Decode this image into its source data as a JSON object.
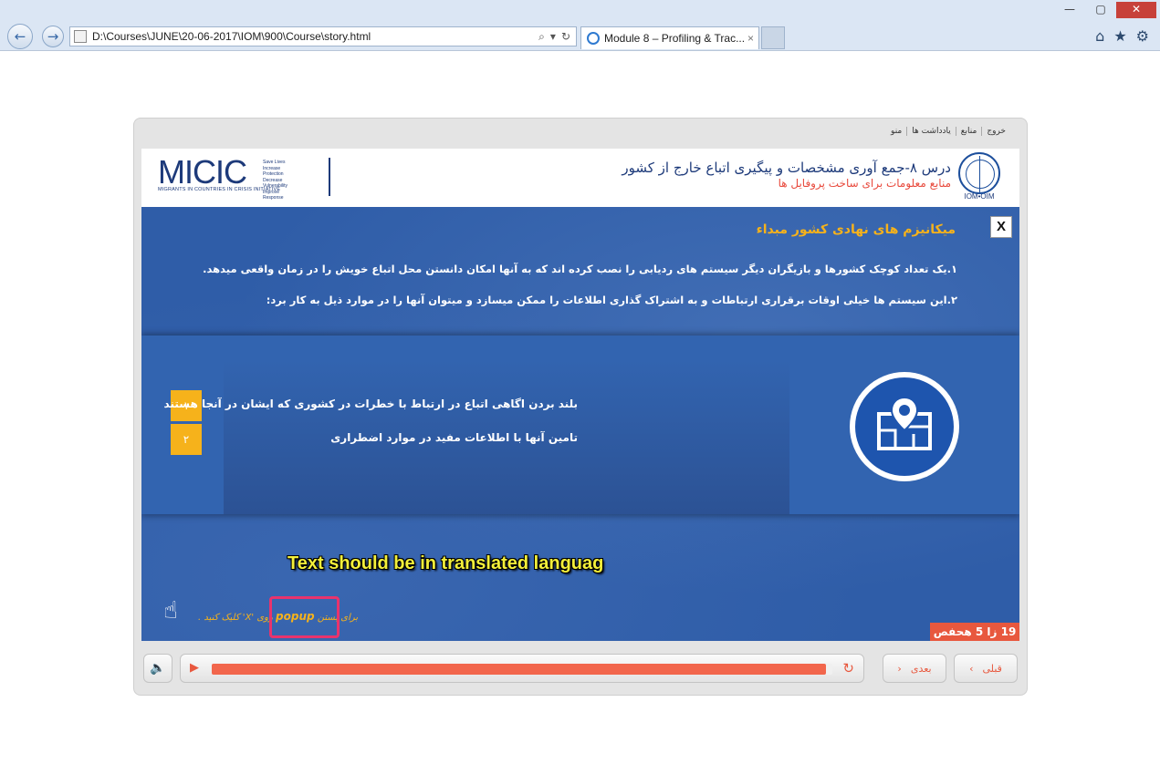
{
  "browser": {
    "address_url": "D:\\Courses\\JUNE\\20-06-2017\\IOM\\900\\Course\\story.html",
    "tab_title": "Module 8 – Profiling & Trac...",
    "tab_close": "×",
    "back_glyph": "←",
    "forward_glyph": "→",
    "search_glyph": "⌕",
    "dropdown_glyph": "▾",
    "refresh_glyph": "↻",
    "home_glyph": "⌂",
    "fav_glyph": "★",
    "settings_glyph": "⚙",
    "minimize_glyph": "—",
    "maximize_glyph": "▢",
    "close_glyph": "✕"
  },
  "topnav": {
    "menu": "منو",
    "notes": "یادداشت ها",
    "resources": "منابع",
    "exit": "خروج"
  },
  "header": {
    "micic_logo": "MICIC",
    "micic_tagline": [
      "Save Lives",
      "Increase Protection",
      "Decrease Vulnerability",
      "Improve Response"
    ],
    "micic_subtitle": "MIGRANTS IN COUNTRIES IN CRISIS INITIATIVE",
    "title": "درس ۸-جمع آوری مشخصات و پیگیری اتباع خارج از کشور",
    "subtitle": "منابع معلومات برای ساخت پروفایل ها",
    "iom_label": "IOM•OIM"
  },
  "slide": {
    "close_label": "X",
    "title": "میکانیزم های نهادی کشور مبداء",
    "line1": "۱.یک تعداد کوچک کشورها و بازیگران دیگر سیستم های ردیابی را نصب کرده اند که به آنها امکان دانستن محل اتباع خویش را در زمان واقعی میدهد.",
    "line2": "۲.این سیستم ها خیلی اوقات برقراری ارتباطات و به اشتراک گذاری اطلاعات را ممکن میسازد و میتوان آنها را در موارد ذیل به کار برد:",
    "items": [
      {
        "num": "۱",
        "text": "بلند بردن اگاهی اتباع در ارتباط با خطرات در کشوری که ایشان در آنجا هستند"
      },
      {
        "num": "۲",
        "text": "تامین آنها با اطلاعات مفید در موارد اضطراری"
      }
    ],
    "warning": "Text should be in translated languag",
    "hint_prefix": "برای بستن",
    "hint_popup": "popup",
    "hint_suffix": "روی 'X' کلیک کنید .",
    "page_badge": "19 زا 5 هحفص"
  },
  "controls": {
    "progress": 0.99,
    "next_label": "بعدی",
    "next_glyph": "‹",
    "prev_label": "قبلی",
    "prev_glyph": "›",
    "volume_glyph": "🔈",
    "play_glyph": "▶",
    "replay_glyph": "↻"
  },
  "colors": {
    "accent_orange": "#f2664c",
    "yellow": "#f6b21b",
    "slide_blue": "#2f5da8",
    "highlight_pink": "#e8336d"
  }
}
